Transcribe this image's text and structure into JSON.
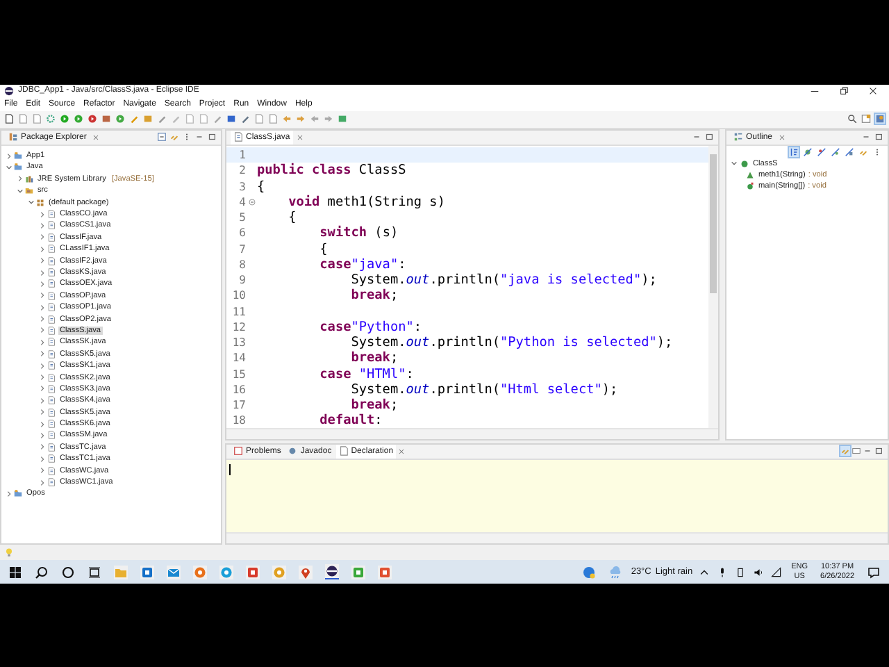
{
  "window": {
    "title": "JDBC_App1 - Java/src/ClassS.java - Eclipse IDE"
  },
  "menu": [
    "File",
    "Edit",
    "Source",
    "Refactor",
    "Navigate",
    "Search",
    "Project",
    "Run",
    "Window",
    "Help"
  ],
  "package_explorer": {
    "title": "Package Explorer",
    "tree": [
      {
        "label": "App1",
        "expanded": false,
        "selected": false
      },
      {
        "label": "Java",
        "expanded": true,
        "selected": false,
        "children": [
          {
            "label": "JRE System Library",
            "decoration": "[JavaSE-15]",
            "expanded": false,
            "selected": false
          },
          {
            "label": "src",
            "expanded": true,
            "selected": false,
            "children": [
              {
                "label": "(default package)",
                "expanded": true,
                "selected": false,
                "children": [
                  {
                    "label": "ClassCO.java",
                    "expanded": false,
                    "selected": false
                  },
                  {
                    "label": "ClassCS1.java",
                    "expanded": false,
                    "selected": false
                  },
                  {
                    "label": "ClassIF.java",
                    "expanded": false,
                    "selected": false
                  },
                  {
                    "label": "CLassIF1.java",
                    "expanded": false,
                    "selected": false
                  },
                  {
                    "label": "ClassIF2.java",
                    "expanded": false,
                    "selected": false
                  },
                  {
                    "label": "ClassKS.java",
                    "expanded": false,
                    "selected": false
                  },
                  {
                    "label": "ClassOEX.java",
                    "expanded": false,
                    "selected": false
                  },
                  {
                    "label": "ClassOP.java",
                    "expanded": false,
                    "selected": false
                  },
                  {
                    "label": "ClassOP1.java",
                    "expanded": false,
                    "selected": false
                  },
                  {
                    "label": "ClassOP2.java",
                    "expanded": false,
                    "selected": false
                  },
                  {
                    "label": "ClassS.java",
                    "expanded": false,
                    "selected": true
                  },
                  {
                    "label": "ClassSK.java",
                    "expanded": false,
                    "selected": false
                  },
                  {
                    "label": "ClassSK5.java",
                    "expanded": false,
                    "selected": false
                  },
                  {
                    "label": "ClassSK1.java",
                    "expanded": false,
                    "selected": false
                  },
                  {
                    "label": "ClassSK2.java",
                    "expanded": false,
                    "selected": false
                  },
                  {
                    "label": "ClassSK3.java",
                    "expanded": false,
                    "selected": false
                  },
                  {
                    "label": "ClassSK4.java",
                    "expanded": false,
                    "selected": false
                  },
                  {
                    "label": "ClassSK5.java",
                    "expanded": false,
                    "selected": false
                  },
                  {
                    "label": "ClassSK6.java",
                    "expanded": false,
                    "selected": false
                  },
                  {
                    "label": "ClassSM.java",
                    "expanded": false,
                    "selected": false
                  },
                  {
                    "label": "ClassTC.java",
                    "expanded": false,
                    "selected": false
                  },
                  {
                    "label": "ClassTC1.java",
                    "expanded": false,
                    "selected": false
                  },
                  {
                    "label": "ClassWC.java",
                    "expanded": false,
                    "selected": false
                  },
                  {
                    "label": "ClassWC1.java",
                    "expanded": false,
                    "selected": false
                  }
                ]
              }
            ]
          }
        ]
      },
      {
        "label": "Opos",
        "expanded": false,
        "selected": false
      }
    ]
  },
  "editor": {
    "tab": "ClassS.java",
    "lines": [
      {
        "number": "1",
        "current": true,
        "folding": false
      },
      {
        "number": "2",
        "current": false,
        "folding": false,
        "segments": [
          {
            "kind": "kw",
            "text": "public class"
          },
          {
            "kind": "plain",
            "text": " ClassS"
          }
        ]
      },
      {
        "number": "3",
        "current": false,
        "folding": false,
        "segments": [
          {
            "kind": "plain",
            "text": "{"
          }
        ]
      },
      {
        "number": "4",
        "current": false,
        "folding": true,
        "segments": [
          {
            "kind": "kw",
            "text": "    void"
          },
          {
            "kind": "plain",
            "text": " meth1(String s)"
          }
        ]
      },
      {
        "number": "5",
        "current": false,
        "folding": false,
        "segments": [
          {
            "kind": "plain",
            "text": "    {"
          }
        ]
      },
      {
        "number": "6",
        "current": false,
        "folding": false,
        "segments": [
          {
            "kind": "kw",
            "text": "        switch"
          },
          {
            "kind": "plain",
            "text": " (s)"
          }
        ]
      },
      {
        "number": "7",
        "current": false,
        "folding": false,
        "segments": [
          {
            "kind": "plain",
            "text": "        {"
          }
        ]
      },
      {
        "number": "8",
        "current": false,
        "folding": false,
        "segments": [
          {
            "kind": "kw",
            "text": "        case"
          },
          {
            "kind": "str",
            "text": "\"java\""
          },
          {
            "kind": "plain",
            "text": ":"
          }
        ]
      },
      {
        "number": "9",
        "current": false,
        "folding": false,
        "segments": [
          {
            "kind": "plain",
            "text": "            System."
          },
          {
            "kind": "field",
            "text": "out"
          },
          {
            "kind": "plain",
            "text": ".println("
          },
          {
            "kind": "str",
            "text": "\"java is selected\""
          },
          {
            "kind": "plain",
            "text": ");"
          }
        ]
      },
      {
        "number": "10",
        "current": false,
        "folding": false,
        "segments": [
          {
            "kind": "kw",
            "text": "            break"
          },
          {
            "kind": "plain",
            "text": ";"
          }
        ]
      },
      {
        "number": "11",
        "current": false,
        "folding": false
      },
      {
        "number": "12",
        "current": false,
        "folding": false,
        "segments": [
          {
            "kind": "kw",
            "text": "        case"
          },
          {
            "kind": "str",
            "text": "\"Python\""
          },
          {
            "kind": "plain",
            "text": ":"
          }
        ]
      },
      {
        "number": "13",
        "current": false,
        "folding": false,
        "segments": [
          {
            "kind": "plain",
            "text": "            System."
          },
          {
            "kind": "field",
            "text": "out"
          },
          {
            "kind": "plain",
            "text": ".println("
          },
          {
            "kind": "str",
            "text": "\"Python is selected\""
          },
          {
            "kind": "plain",
            "text": ");"
          }
        ]
      },
      {
        "number": "14",
        "current": false,
        "folding": false,
        "segments": [
          {
            "kind": "kw",
            "text": "            break"
          },
          {
            "kind": "plain",
            "text": ";"
          }
        ]
      },
      {
        "number": "15",
        "current": false,
        "folding": false,
        "segments": [
          {
            "kind": "kw",
            "text": "        case"
          },
          {
            "kind": "str",
            "text": " \"HTMl\""
          },
          {
            "kind": "plain",
            "text": ":"
          }
        ]
      },
      {
        "number": "16",
        "current": false,
        "folding": false,
        "segments": [
          {
            "kind": "plain",
            "text": "            System."
          },
          {
            "kind": "field",
            "text": "out"
          },
          {
            "kind": "plain",
            "text": ".println("
          },
          {
            "kind": "str",
            "text": "\"Html select\""
          },
          {
            "kind": "plain",
            "text": ");"
          }
        ]
      },
      {
        "number": "17",
        "current": false,
        "folding": false,
        "segments": [
          {
            "kind": "kw",
            "text": "            break"
          },
          {
            "kind": "plain",
            "text": ";"
          }
        ]
      },
      {
        "number": "18",
        "current": false,
        "folding": false,
        "segments": [
          {
            "kind": "kw",
            "text": "        default"
          },
          {
            "kind": "plain",
            "text": ":"
          }
        ]
      }
    ]
  },
  "outline": {
    "title": "Outline",
    "items": [
      {
        "label": "ClassS",
        "kind": "class",
        "expanded": true,
        "children": [
          {
            "label": "meth1(String)",
            "type": ": void",
            "kind": "method"
          },
          {
            "label": "main(String[])",
            "type": ": void",
            "kind": "static-method"
          }
        ]
      }
    ]
  },
  "bottom_panel": {
    "tabs": [
      {
        "label": "Problems",
        "selected": false
      },
      {
        "label": "Javadoc",
        "selected": false
      },
      {
        "label": "Declaration",
        "selected": true
      }
    ]
  },
  "taskbar": {
    "weather": {
      "temperature": "23°C",
      "condition": "Light rain"
    },
    "language": "ENG",
    "region": "US",
    "time": "10:37 PM",
    "date": "6/26/2022"
  }
}
